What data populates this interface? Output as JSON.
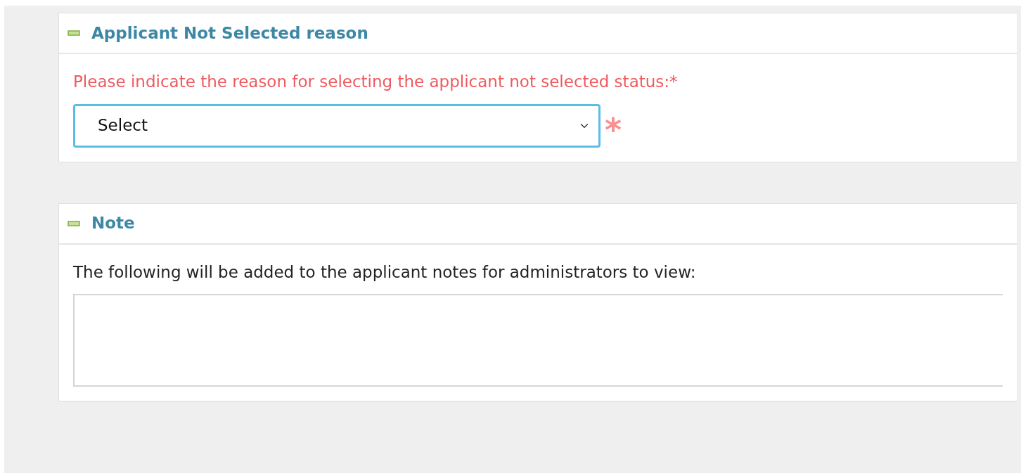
{
  "sections": [
    {
      "title": "Applicant Not Selected reason",
      "expanded": true,
      "kind": "select",
      "prompt": "Please indicate the reason for selecting the applicant not selected status:*",
      "field": {
        "value": "Select"
      },
      "required_mark": "*"
    },
    {
      "title": "Note",
      "expanded": true,
      "kind": "textarea",
      "prompt": "The following will be added to the applicant notes for administrators to view:"
    }
  ]
}
